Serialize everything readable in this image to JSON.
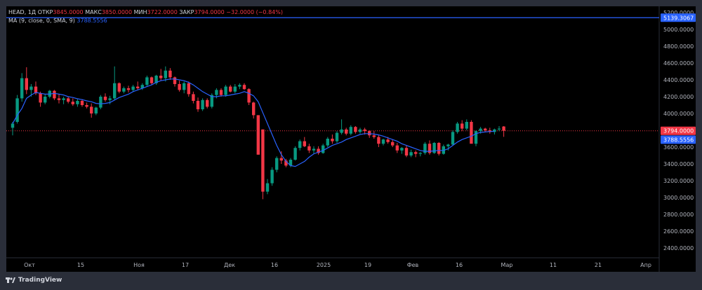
{
  "legend": {
    "symbol": "HEAD, 1Д",
    "open_label": "ОТКР",
    "open_value": "3845.0000",
    "high_label": "МАКС",
    "high_value": "3850.0000",
    "low_label": "МИН",
    "low_value": "3722.0000",
    "close_label": "ЗАКР",
    "close_value": "3794.0000",
    "change_value": "−32.0000 (−0.84%)",
    "ma_label": "MA (9, close, 0, SMA, 9)",
    "ma_value": "3788.5556"
  },
  "price_axis": {
    "ticks": [
      "5200.0000",
      "5000.0000",
      "4800.0000",
      "4600.0000",
      "4400.0000",
      "4200.0000",
      "4000.0000",
      "3800.0000",
      "3600.0000",
      "3400.0000",
      "3200.0000",
      "3000.0000",
      "2800.0000",
      "2600.0000",
      "2400.0000"
    ],
    "horizontal_line_label": "5139.3067",
    "close_label": "3794.0000",
    "ma_label": "3788.5556"
  },
  "time_axis": {
    "ticks": [
      "Окт",
      "15",
      "Ноя",
      "17",
      "Дек",
      "16",
      "2025",
      "19",
      "Фев",
      "16",
      "Мар",
      "11",
      "21",
      "Апр"
    ]
  },
  "footer": {
    "brand": "TradingView"
  },
  "colors": {
    "up": "#089981",
    "down": "#f23645",
    "ma": "#2962ff",
    "hline": "#2962ff",
    "background": "#000000",
    "frame": "#2a2e39"
  },
  "chart_data": {
    "type": "candlestick",
    "title": "HEAD, 1Д",
    "ylim": [
      2300,
      5250
    ],
    "horizontal_line": 5139.3067,
    "series": [
      {
        "name": "HEAD",
        "ohlc": [
          [
            3830,
            3900,
            3740,
            3880
          ],
          [
            3900,
            4220,
            3880,
            4180
          ],
          [
            4180,
            4480,
            4140,
            4420
          ],
          [
            4420,
            4550,
            4230,
            4280
          ],
          [
            4280,
            4350,
            4200,
            4320
          ],
          [
            4320,
            4380,
            4220,
            4240
          ],
          [
            4240,
            4260,
            4080,
            4130
          ],
          [
            4130,
            4230,
            4110,
            4200
          ],
          [
            4200,
            4280,
            4180,
            4270
          ],
          [
            4270,
            4280,
            4160,
            4180
          ],
          [
            4180,
            4230,
            4120,
            4160
          ],
          [
            4160,
            4200,
            4110,
            4180
          ],
          [
            4180,
            4200,
            4120,
            4140
          ],
          [
            4140,
            4180,
            4090,
            4110
          ],
          [
            4110,
            4170,
            4080,
            4150
          ],
          [
            4150,
            4170,
            4080,
            4100
          ],
          [
            4100,
            4130,
            4060,
            4080
          ],
          [
            4080,
            4120,
            3950,
            4000
          ],
          [
            4000,
            4080,
            3980,
            4070
          ],
          [
            4070,
            4220,
            4050,
            4200
          ],
          [
            4200,
            4240,
            4140,
            4160
          ],
          [
            4160,
            4210,
            4110,
            4180
          ],
          [
            4180,
            4560,
            4160,
            4360
          ],
          [
            4360,
            4370,
            4240,
            4260
          ],
          [
            4260,
            4320,
            4240,
            4300
          ],
          [
            4300,
            4330,
            4250,
            4280
          ],
          [
            4280,
            4340,
            4260,
            4320
          ],
          [
            4320,
            4380,
            4280,
            4300
          ],
          [
            4300,
            4360,
            4280,
            4340
          ],
          [
            4340,
            4450,
            4320,
            4430
          ],
          [
            4430,
            4440,
            4340,
            4360
          ],
          [
            4360,
            4460,
            4340,
            4450
          ],
          [
            4450,
            4530,
            4390,
            4420
          ],
          [
            4420,
            4560,
            4380,
            4510
          ],
          [
            4510,
            4540,
            4400,
            4430
          ],
          [
            4430,
            4440,
            4320,
            4350
          ],
          [
            4350,
            4390,
            4260,
            4280
          ],
          [
            4280,
            4380,
            4240,
            4360
          ],
          [
            4360,
            4380,
            4200,
            4230
          ],
          [
            4230,
            4260,
            4120,
            4150
          ],
          [
            4150,
            4190,
            4020,
            4050
          ],
          [
            4050,
            4180,
            4030,
            4160
          ],
          [
            4160,
            4180,
            4060,
            4080
          ],
          [
            4080,
            4240,
            4060,
            4220
          ],
          [
            4220,
            4300,
            4180,
            4280
          ],
          [
            4280,
            4300,
            4200,
            4220
          ],
          [
            4220,
            4340,
            4200,
            4320
          ],
          [
            4320,
            4340,
            4250,
            4260
          ],
          [
            4260,
            4350,
            4240,
            4320
          ],
          [
            4320,
            4360,
            4290,
            4340
          ],
          [
            4340,
            4360,
            4280,
            4290
          ],
          [
            4290,
            4300,
            4100,
            4130
          ],
          [
            4130,
            4140,
            3940,
            3980
          ],
          [
            3980,
            3980,
            3510,
            3510
          ],
          [
            3810,
            3810,
            2980,
            3070
          ],
          [
            3070,
            3220,
            3040,
            3170
          ],
          [
            3170,
            3360,
            3140,
            3330
          ],
          [
            3330,
            3490,
            3300,
            3470
          ],
          [
            3470,
            3550,
            3400,
            3440
          ],
          [
            3440,
            3460,
            3360,
            3380
          ],
          [
            3380,
            3470,
            3360,
            3450
          ],
          [
            3450,
            3610,
            3440,
            3590
          ],
          [
            3590,
            3690,
            3560,
            3670
          ],
          [
            3670,
            3720,
            3600,
            3610
          ],
          [
            3610,
            3640,
            3530,
            3560
          ],
          [
            3560,
            3610,
            3520,
            3580
          ],
          [
            3580,
            3610,
            3510,
            3530
          ],
          [
            3530,
            3640,
            3520,
            3620
          ],
          [
            3620,
            3720,
            3600,
            3700
          ],
          [
            3700,
            3750,
            3640,
            3670
          ],
          [
            3670,
            3790,
            3650,
            3770
          ],
          [
            3770,
            3930,
            3750,
            3810
          ],
          [
            3810,
            3830,
            3740,
            3760
          ],
          [
            3760,
            3860,
            3740,
            3840
          ],
          [
            3840,
            3850,
            3760,
            3780
          ],
          [
            3780,
            3830,
            3760,
            3810
          ],
          [
            3810,
            3830,
            3750,
            3790
          ],
          [
            3790,
            3800,
            3710,
            3740
          ],
          [
            3740,
            3790,
            3700,
            3720
          ],
          [
            3720,
            3740,
            3600,
            3640
          ],
          [
            3640,
            3700,
            3620,
            3690
          ],
          [
            3690,
            3720,
            3640,
            3660
          ],
          [
            3660,
            3690,
            3600,
            3620
          ],
          [
            3620,
            3650,
            3530,
            3560
          ],
          [
            3560,
            3600,
            3520,
            3590
          ],
          [
            3590,
            3620,
            3480,
            3500
          ],
          [
            3500,
            3570,
            3480,
            3540
          ],
          [
            3540,
            3560,
            3480,
            3520
          ],
          [
            3520,
            3540,
            3490,
            3530
          ],
          [
            3530,
            3660,
            3510,
            3640
          ],
          [
            3640,
            3680,
            3510,
            3530
          ],
          [
            3530,
            3660,
            3520,
            3650
          ],
          [
            3650,
            3660,
            3500,
            3520
          ],
          [
            3520,
            3630,
            3510,
            3610
          ],
          [
            3610,
            3640,
            3560,
            3630
          ],
          [
            3630,
            3800,
            3620,
            3780
          ],
          [
            3780,
            3900,
            3760,
            3880
          ],
          [
            3880,
            3920,
            3790,
            3820
          ],
          [
            3820,
            3930,
            3800,
            3900
          ],
          [
            3900,
            3920,
            3750,
            3640
          ],
          [
            3640,
            3800,
            3610,
            3790
          ],
          [
            3790,
            3840,
            3760,
            3820
          ],
          [
            3820,
            3830,
            3780,
            3800
          ],
          [
            3800,
            3830,
            3760,
            3780
          ],
          [
            3780,
            3820,
            3750,
            3810
          ],
          [
            3810,
            3850,
            3790,
            3820
          ],
          [
            3845,
            3850,
            3722,
            3794
          ]
        ]
      },
      {
        "name": "MA (9, close, 0, SMA, 9)",
        "values": [
          3880,
          3980,
          4060,
          4180,
          4220,
          4250,
          4240,
          4230,
          4230,
          4240,
          4230,
          4220,
          4200,
          4190,
          4175,
          4165,
          4150,
          4140,
          4120,
          4115,
          4120,
          4130,
          4160,
          4190,
          4210,
          4230,
          4260,
          4280,
          4300,
          4320,
          4340,
          4370,
          4390,
          4400,
          4410,
          4410,
          4400,
          4390,
          4370,
          4340,
          4300,
          4260,
          4230,
          4200,
          4200,
          4210,
          4210,
          4220,
          4230,
          4240,
          4260,
          4240,
          4210,
          4140,
          4010,
          3880,
          3750,
          3620,
          3510,
          3430,
          3380,
          3370,
          3400,
          3430,
          3480,
          3520,
          3540,
          3560,
          3590,
          3620,
          3640,
          3660,
          3690,
          3710,
          3730,
          3750,
          3760,
          3760,
          3755,
          3745,
          3730,
          3710,
          3690,
          3670,
          3640,
          3620,
          3600,
          3580,
          3560,
          3550,
          3550,
          3555,
          3560,
          3560,
          3580,
          3620,
          3660,
          3690,
          3710,
          3730,
          3760,
          3775,
          3780,
          3785,
          3788.5556
        ]
      }
    ],
    "x_ticks": [
      "Окт",
      "15",
      "Ноя",
      "17",
      "Дек",
      "16",
      "2025",
      "19",
      "Фев",
      "16",
      "Мар",
      "11",
      "21",
      "Апр"
    ],
    "y_ticks": [
      5200,
      5000,
      4800,
      4600,
      4400,
      4200,
      4000,
      3800,
      3600,
      3400,
      3200,
      3000,
      2800,
      2600,
      2400
    ]
  }
}
